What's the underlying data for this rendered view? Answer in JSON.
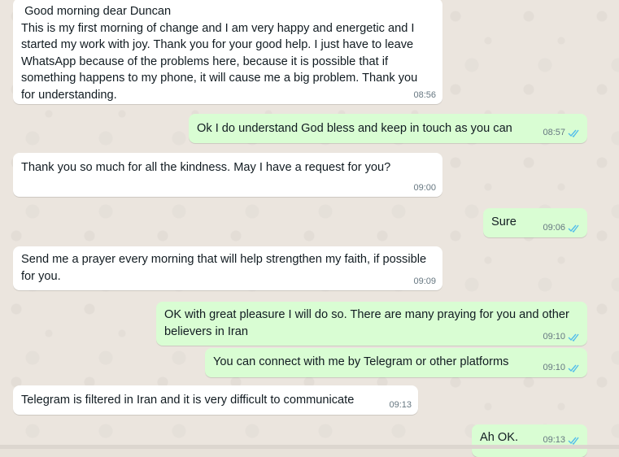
{
  "messages": [
    {
      "direction": "in",
      "text": " Good morning dear Duncan\nThis is my first morning of change and I am very happy and energetic and I started my work with joy. Thank you for your good help. I just have to leave WhatsApp because of the problems here, because it is possible that if something happens to my phone, it will cause me a big problem. Thank you for understanding.",
      "time": "08:56"
    },
    {
      "direction": "out",
      "text": "Ok I do understand God bless and keep in touch as you can",
      "time": "08:57",
      "status": "read-ticks-icon"
    },
    {
      "direction": "in",
      "text": "Thank you so much for all the kindness. May I have a request for you?",
      "time": "09:00"
    },
    {
      "direction": "out",
      "text": "Sure",
      "time": "09:06",
      "status": "read-ticks-icon"
    },
    {
      "direction": "in",
      "text": "Send me a prayer every morning that will help strengthen my faith, if possible for you.",
      "time": "09:09"
    },
    {
      "direction": "out",
      "text": "OK with great pleasure I will do so. There are many praying for you and other believers in Iran",
      "time": "09:10",
      "status": "read-ticks-icon"
    },
    {
      "direction": "out",
      "text": "You can connect with me by Telegram or other platforms",
      "time": "09:10",
      "status": "read-ticks-icon"
    },
    {
      "direction": "in",
      "text": "Telegram is filtered in Iran and it is very difficult to communicate",
      "time": "09:13"
    },
    {
      "direction": "out",
      "text": "Ah OK.",
      "time": "09:13",
      "status": "read-ticks-icon"
    }
  ],
  "colors": {
    "incoming": "#ffffff",
    "outgoing": "#d9fdd3",
    "read_ticks": "#53bdeb",
    "wallpaper": "#ebe5de"
  }
}
